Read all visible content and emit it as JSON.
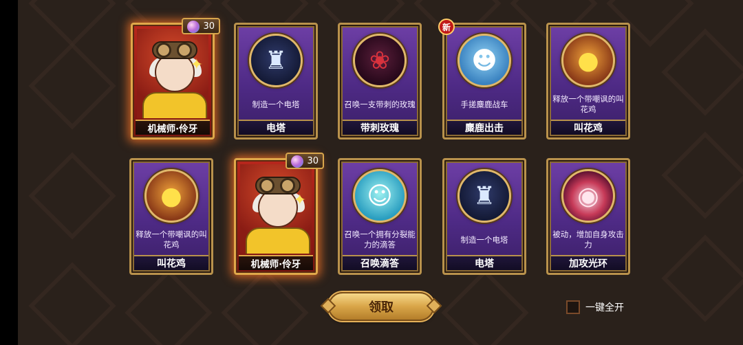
{
  "cards": [
    {
      "type": "hero",
      "name": "机械师·伶牙",
      "cost": "30"
    },
    {
      "type": "skill",
      "icon": "tower-icon",
      "desc": "制造一个电塔",
      "name": "电塔"
    },
    {
      "type": "skill",
      "icon": "rose-icon",
      "desc": "召唤一支带刺的玫瑰",
      "name": "带刺玫瑰"
    },
    {
      "type": "skill",
      "icon": "chariot-icon",
      "desc": "手搓麋鹿战车",
      "name": "麋鹿出击",
      "badge": "新"
    },
    {
      "type": "skill",
      "icon": "chick-icon",
      "desc": "释放一个带嘲讽的叫花鸡",
      "name": "叫花鸡"
    },
    {
      "type": "skill",
      "icon": "chick-icon",
      "desc": "释放一个带嘲讽的叫花鸡",
      "name": "叫花鸡"
    },
    {
      "type": "hero",
      "name": "机械师·伶牙",
      "cost": "30"
    },
    {
      "type": "skill",
      "icon": "slime-icon",
      "desc": "召唤一个拥有分裂能力的滴答",
      "name": "召唤滴答"
    },
    {
      "type": "skill",
      "icon": "tower-icon",
      "desc": "制造一个电塔",
      "name": "电塔"
    },
    {
      "type": "skill",
      "icon": "aura-icon",
      "desc": "被动，增加自身攻击力",
      "name": "加攻光环"
    }
  ],
  "claim_button": "领取",
  "open_all": {
    "label": "一键全开",
    "checked": false
  },
  "colors": {
    "background": "#2a211b",
    "skill_card": "#5a318f",
    "hero_card": "#b8261c",
    "gold_frame": "#b9924c",
    "new_badge": "#c01818"
  }
}
